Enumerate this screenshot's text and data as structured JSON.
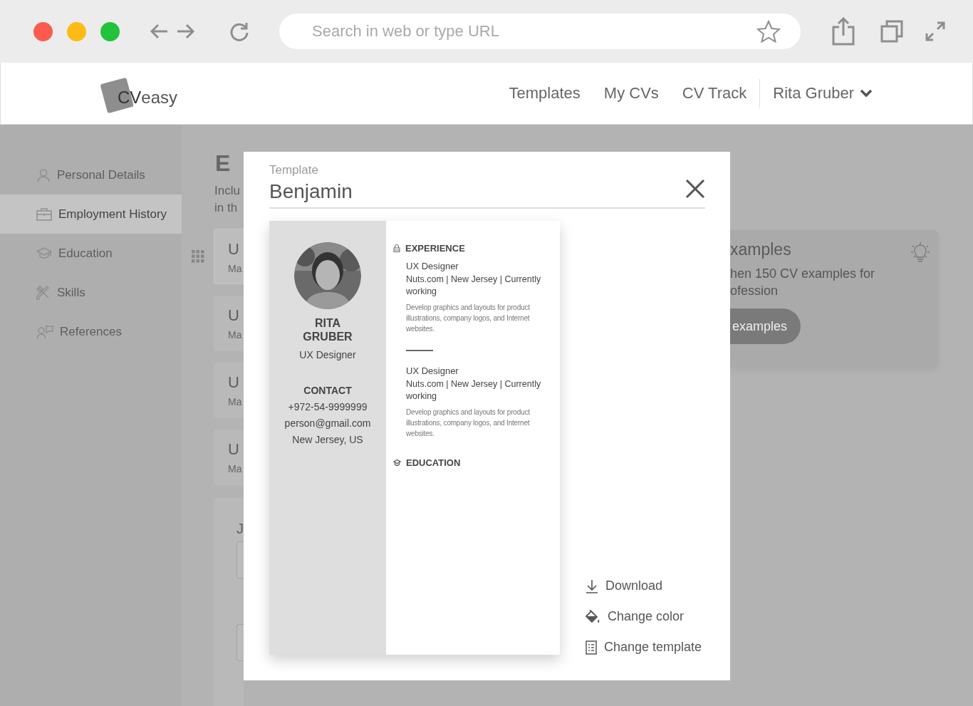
{
  "browser": {
    "url_placeholder": "Search in web or type URL"
  },
  "header": {
    "logo": {
      "strong": "CV",
      "light": "easy"
    },
    "nav": [
      {
        "label": "Templates",
        "selected": false
      },
      {
        "label": "My CVs",
        "selected": false
      },
      {
        "label": "CV Track",
        "selected": false
      }
    ],
    "user": {
      "name": "Rita Gruber"
    }
  },
  "sidebar": {
    "items": [
      {
        "label": "Personal Details",
        "selected": false
      },
      {
        "label": "Employment History",
        "selected": true
      },
      {
        "label": "Education",
        "selected": false
      },
      {
        "label": "Skills",
        "selected": false
      },
      {
        "label": "References",
        "selected": false
      }
    ]
  },
  "background": {
    "heading": "E",
    "intro_lines": [
      "Inclu",
      "in th"
    ],
    "cards": [
      {
        "title": "U",
        "subtitle": "Ma"
      },
      {
        "title": "U",
        "subtitle": "Ma"
      },
      {
        "title": "U",
        "subtitle": "Ma"
      },
      {
        "title": "U",
        "subtitle": "Ma"
      }
    ],
    "form_label": "J",
    "examples": {
      "title": "xamples",
      "lines": [
        "hen 150 CV examples for",
        "ofession"
      ],
      "button": "examples"
    }
  },
  "modal": {
    "label": "Template",
    "title": "Benjamin",
    "cv": {
      "name_lines": [
        "RITA",
        "GRUBER"
      ],
      "role": "UX Designer",
      "contact_heading": "CONTACT",
      "contact": [
        "+972-54-9999999",
        "person@gmail.com",
        "New Jersey, US"
      ],
      "sections": [
        {
          "heading": "EXPERIENCE",
          "entries": [
            {
              "title": "UX Designer",
              "meta": "Nuts.com | New Jersey | Currently working",
              "description": "Develop graphics and layouts for product illustrations, company logos, and Internet websites."
            },
            {
              "title": "UX Designer",
              "meta": "Nuts.com | New Jersey | Currently working",
              "description": "Develop graphics and layouts for product illustrations, company logos, and Internet websites."
            }
          ]
        },
        {
          "heading": "EDUCATION"
        }
      ]
    },
    "actions": [
      {
        "label": "Download"
      },
      {
        "label": "Change color"
      },
      {
        "label": "Change template"
      }
    ]
  }
}
